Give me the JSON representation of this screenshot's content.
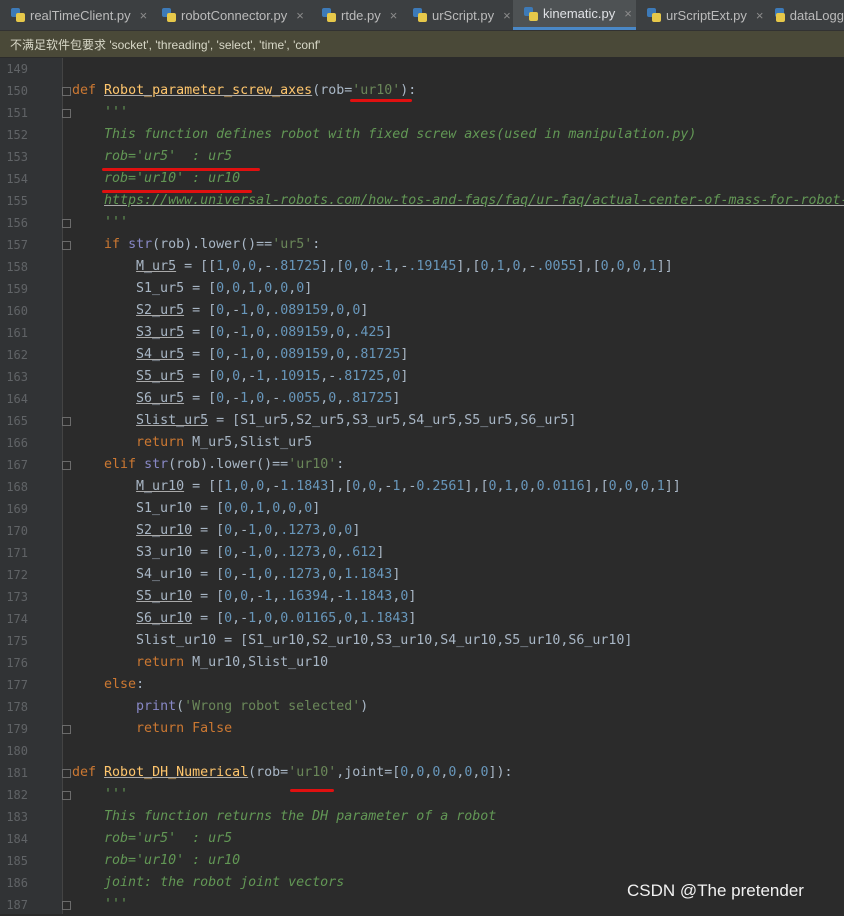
{
  "tabs": [
    {
      "label": "realTimeClient.py",
      "active": false
    },
    {
      "label": "robotConnector.py",
      "active": false
    },
    {
      "label": "rtde.py",
      "active": false
    },
    {
      "label": "urScript.py",
      "active": false
    },
    {
      "label": "kinematic.py",
      "active": true
    },
    {
      "label": "urScriptExt.py",
      "active": false
    },
    {
      "label": "dataLogg",
      "active": false
    }
  ],
  "close_glyph": "×",
  "banner": "不满足软件包要求 'socket', 'threading', 'select', 'time', 'conf'",
  "lines": [
    {
      "n": "149",
      "html": ""
    },
    {
      "n": "150",
      "html": "<span class=\"kw\">def</span> <span class=\"fn ul\">Robot_parameter_screw_axes</span>(rob=<span class=\"str\">'ur10'</span>):"
    },
    {
      "n": "151",
      "html": "    <span class=\"doc\">'''</span>"
    },
    {
      "n": "152",
      "html": "    <span class=\"doc\">This function defines robot with fixed screw axes(used in manipulation.py)</span>"
    },
    {
      "n": "153",
      "html": "    <span class=\"doc\">rob='ur5'  : ur5</span>"
    },
    {
      "n": "154",
      "html": "    <span class=\"doc\">rob='ur10' : ur10</span>"
    },
    {
      "n": "155",
      "html": "    <span class=\"doc ul\">https://www.universal-robots.com/how-tos-and-faqs/faq/ur-faq/actual-center-of-mass-for-robot-</span>"
    },
    {
      "n": "156",
      "html": "    <span class=\"doc\">'''</span>"
    },
    {
      "n": "157",
      "html": "    <span class=\"kw\">if</span> <span class=\"bi\">str</span>(rob).lower()==<span class=\"str\">'ur5'</span>:"
    },
    {
      "n": "158",
      "html": "        <span class=\"ul\">M_ur5</span> = [[<span class=\"num\">1</span>,<span class=\"num\">0</span>,<span class=\"num\">0</span>,-<span class=\"num\">.81725</span>],[<span class=\"num\">0</span>,<span class=\"num\">0</span>,-<span class=\"num\">1</span>,-<span class=\"num\">.19145</span>],[<span class=\"num\">0</span>,<span class=\"num\">1</span>,<span class=\"num\">0</span>,-<span class=\"num\">.0055</span>],[<span class=\"num\">0</span>,<span class=\"num\">0</span>,<span class=\"num\">0</span>,<span class=\"num\">1</span>]]"
    },
    {
      "n": "159",
      "html": "        S1_ur5 = [<span class=\"num\">0</span>,<span class=\"num\">0</span>,<span class=\"num\">1</span>,<span class=\"num\">0</span>,<span class=\"num\">0</span>,<span class=\"num\">0</span>]"
    },
    {
      "n": "160",
      "html": "        <span class=\"ul\">S2_ur5</span> = [<span class=\"num\">0</span>,-<span class=\"num\">1</span>,<span class=\"num\">0</span>,<span class=\"num\">.089159</span>,<span class=\"num\">0</span>,<span class=\"num\">0</span>]"
    },
    {
      "n": "161",
      "html": "        <span class=\"ul\">S3_ur5</span> = [<span class=\"num\">0</span>,-<span class=\"num\">1</span>,<span class=\"num\">0</span>,<span class=\"num\">.089159</span>,<span class=\"num\">0</span>,<span class=\"num\">.425</span>]"
    },
    {
      "n": "162",
      "html": "        <span class=\"ul\">S4_ur5</span> = [<span class=\"num\">0</span>,-<span class=\"num\">1</span>,<span class=\"num\">0</span>,<span class=\"num\">.089159</span>,<span class=\"num\">0</span>,<span class=\"num\">.81725</span>]"
    },
    {
      "n": "163",
      "html": "        <span class=\"ul\">S5_ur5</span> = [<span class=\"num\">0</span>,<span class=\"num\">0</span>,-<span class=\"num\">1</span>,<span class=\"num\">.10915</span>,-<span class=\"num\">.81725</span>,<span class=\"num\">0</span>]"
    },
    {
      "n": "164",
      "html": "        <span class=\"ul\">S6_ur5</span> = [<span class=\"num\">0</span>,-<span class=\"num\">1</span>,<span class=\"num\">0</span>,-<span class=\"num\">.0055</span>,<span class=\"num\">0</span>,<span class=\"num\">.81725</span>]"
    },
    {
      "n": "165",
      "html": "        <span class=\"ul\">Slist_ur5</span> = [S1_ur5,S2_ur5,S3_ur5,S4_ur5,S5_ur5,S6_ur5]"
    },
    {
      "n": "166",
      "html": "        <span class=\"kw\">return</span> M_ur5,Slist_ur5"
    },
    {
      "n": "167",
      "html": "    <span class=\"kw\">elif</span> <span class=\"bi\">str</span>(rob).lower()==<span class=\"str\">'ur10'</span>:"
    },
    {
      "n": "168",
      "html": "        <span class=\"ul\">M_ur10</span> = [[<span class=\"num\">1</span>,<span class=\"num\">0</span>,<span class=\"num\">0</span>,-<span class=\"num\">1.1843</span>],[<span class=\"num\">0</span>,<span class=\"num\">0</span>,-<span class=\"num\">1</span>,-<span class=\"num\">0.2561</span>],[<span class=\"num\">0</span>,<span class=\"num\">1</span>,<span class=\"num\">0</span>,<span class=\"num\">0.0116</span>],[<span class=\"num\">0</span>,<span class=\"num\">0</span>,<span class=\"num\">0</span>,<span class=\"num\">1</span>]]"
    },
    {
      "n": "169",
      "html": "        S1_ur10 = [<span class=\"num\">0</span>,<span class=\"num\">0</span>,<span class=\"num\">1</span>,<span class=\"num\">0</span>,<span class=\"num\">0</span>,<span class=\"num\">0</span>]"
    },
    {
      "n": "170",
      "html": "        <span class=\"ul\">S2_ur10</span> = [<span class=\"num\">0</span>,-<span class=\"num\">1</span>,<span class=\"num\">0</span>,<span class=\"num\">.1273</span>,<span class=\"num\">0</span>,<span class=\"num\">0</span>]"
    },
    {
      "n": "171",
      "html": "        S3_ur10 = [<span class=\"num\">0</span>,-<span class=\"num\">1</span>,<span class=\"num\">0</span>,<span class=\"num\">.1273</span>,<span class=\"num\">0</span>,<span class=\"num\">.612</span>]"
    },
    {
      "n": "172",
      "html": "        S4_ur10 = [<span class=\"num\">0</span>,-<span class=\"num\">1</span>,<span class=\"num\">0</span>,<span class=\"num\">.1273</span>,<span class=\"num\">0</span>,<span class=\"num\">1.1843</span>]"
    },
    {
      "n": "173",
      "html": "        <span class=\"ul\">S5_ur10</span> = [<span class=\"num\">0</span>,<span class=\"num\">0</span>,-<span class=\"num\">1</span>,<span class=\"num\">.16394</span>,-<span class=\"num\">1.1843</span>,<span class=\"num\">0</span>]"
    },
    {
      "n": "174",
      "html": "        <span class=\"ul\">S6_ur10</span> = [<span class=\"num\">0</span>,-<span class=\"num\">1</span>,<span class=\"num\">0</span>,<span class=\"num\">0.01165</span>,<span class=\"num\">0</span>,<span class=\"num\">1.1843</span>]"
    },
    {
      "n": "175",
      "html": "        Slist_ur10 = [S1_ur10,S2_ur10,S3_ur10,S4_ur10,S5_ur10,S6_ur10]"
    },
    {
      "n": "176",
      "html": "        <span class=\"kw\">return</span> M_ur10,Slist_ur10"
    },
    {
      "n": "177",
      "html": "    <span class=\"kw\">else</span>:"
    },
    {
      "n": "178",
      "html": "        <span class=\"bi\">print</span>(<span class=\"str\">'Wrong robot selected'</span>)"
    },
    {
      "n": "179",
      "html": "        <span class=\"kw\">return False</span>"
    },
    {
      "n": "180",
      "html": ""
    },
    {
      "n": "181",
      "html": "<span class=\"kw\">def</span> <span class=\"fn ul\">Robot_DH_Numerical</span>(rob=<span class=\"str\">'ur10'</span>,joint=[<span class=\"num\">0</span>,<span class=\"num\">0</span>,<span class=\"num\">0</span>,<span class=\"num\">0</span>,<span class=\"num\">0</span>,<span class=\"num\">0</span>]):"
    },
    {
      "n": "182",
      "html": "    <span class=\"doc\">'''</span>"
    },
    {
      "n": "183",
      "html": "    <span class=\"doc\">This function returns the DH parameter of a robot</span>"
    },
    {
      "n": "184",
      "html": "    <span class=\"doc\">rob='ur5'  : ur5</span>"
    },
    {
      "n": "185",
      "html": "    <span class=\"doc\">rob='ur10' : ur10</span>"
    },
    {
      "n": "186",
      "html": "    <span class=\"doc\">joint: the robot joint vectors</span>"
    },
    {
      "n": "187",
      "html": "    <span class=\"doc\">'''</span>"
    }
  ],
  "watermark": "CSDN @The  pretender"
}
